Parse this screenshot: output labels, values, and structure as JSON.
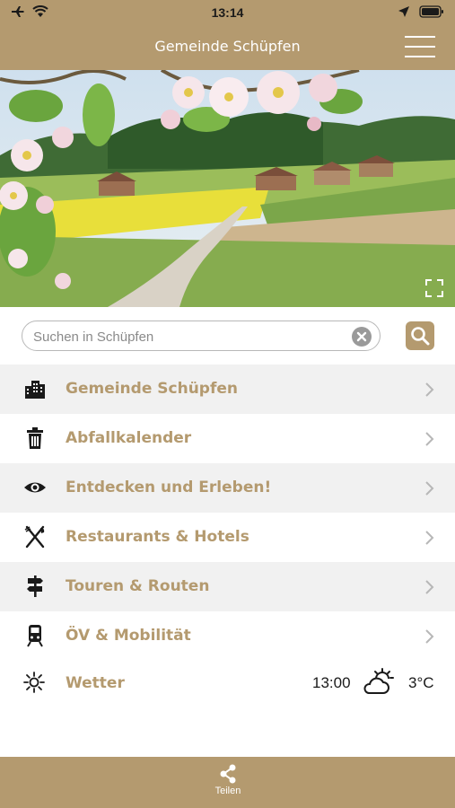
{
  "status_bar": {
    "time": "13:14"
  },
  "nav": {
    "title": "Gemeinde Schüpfen"
  },
  "search": {
    "placeholder": "Suchen in Schüpfen",
    "value": ""
  },
  "menu": [
    {
      "label": "Gemeinde Schüpfen",
      "icon": "buildings-icon"
    },
    {
      "label": "Abfallkalender",
      "icon": "trash-icon"
    },
    {
      "label": "Entdecken und Erleben!",
      "icon": "eye-icon"
    },
    {
      "label": "Restaurants & Hotels",
      "icon": "cutlery-icon"
    },
    {
      "label": "Touren & Routen",
      "icon": "signpost-icon"
    },
    {
      "label": "ÖV & Mobilität",
      "icon": "train-icon"
    }
  ],
  "weather": {
    "label": "Wetter",
    "time": "13:00",
    "temp": "3°C",
    "condition_icon": "partly-cloudy-icon"
  },
  "bottom": {
    "share_label": "Teilen"
  },
  "colors": {
    "brand": "#b49a6f",
    "row_shade": "#f1f1f1"
  }
}
